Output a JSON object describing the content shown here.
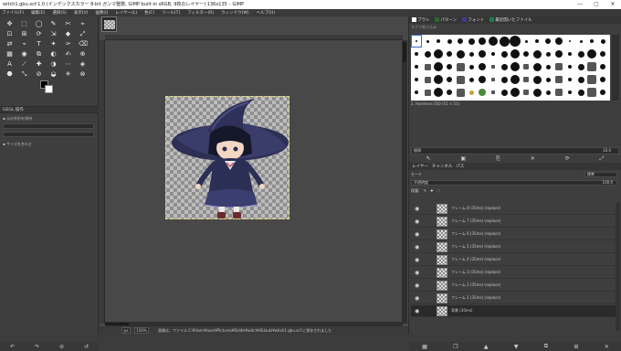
{
  "window": {
    "title": "witch1.gbu.xcf-1.0 (インデックスカラー 8-bit ガンマ整数, GIMP built-in sRGB, 9枚のレイヤー) 136x135 – GIMP",
    "controls": [
      "—",
      "▢",
      "✕"
    ]
  },
  "menu": [
    "ファイル(F)",
    "編集(E)",
    "選択(S)",
    "表示(V)",
    "画像(I)",
    "レイヤー(L)",
    "色(C)",
    "ツール(T)",
    "フィルター(R)",
    "ウィンドウ(W)",
    "ヘルプ(H)"
  ],
  "toolbox": {
    "tool_icons": [
      "✥",
      "⬚",
      "◯",
      "✎",
      "✂",
      "⌖",
      "⊡",
      "⊞",
      "⟳",
      "⇲",
      "◆",
      "⤢",
      "⇄",
      "⌁",
      "T",
      "✦",
      "✑",
      "⌫",
      "▦",
      "◉",
      "⧉",
      "◐",
      "✍",
      "⊕",
      "A",
      "⟋",
      "✚",
      "◑",
      "⋯",
      "◈",
      "⬣",
      "⤡",
      "⊘",
      "◒",
      "✳",
      "⊗"
    ],
    "tool_options_title": "GEGL 操作",
    "option_label_1": "元の外形を保持",
    "option_label_2": "サイズを合わせ",
    "bottom_icons": [
      "↶",
      "↷",
      "⊘",
      "↺"
    ]
  },
  "canvas": {
    "status_unit": "px",
    "status_zoom": "100%",
    "status_message": "画像は、ファイル C:¥Users¥user¥Pictures¥Riddle¥witch¥SUzuki¥witch1.gbu.xcf に保存されました"
  },
  "dock": {
    "top_tabs": [
      {
        "label": "ブラシ",
        "color": "#ffffff"
      },
      {
        "label": "パターン",
        "color": "#2b6b2b"
      },
      {
        "label": "フォント",
        "color": "#3d3d8a"
      },
      {
        "label": "最近開いたファイル",
        "color": "#1f7a4f"
      }
    ],
    "brush_filter_placeholder": "タグで絞り込み",
    "brush_name": "2. Hardness 050 (51 × 51)",
    "spacing_label": "間隔",
    "spacing_value": "10.0",
    "brush_buttons": [
      "✎",
      "▣",
      "⎘",
      "✕",
      "⟳",
      "⤢"
    ],
    "layer_tabs": [
      "レイヤー",
      "チャンネル",
      "パス"
    ],
    "mode_label": "モード",
    "mode_value": "標準",
    "opacity_label": "不透明度",
    "opacity_value": "100.0",
    "lock_label": "保護:",
    "lock_icons": [
      "✎",
      "✚",
      "⛶"
    ],
    "layers": [
      {
        "name": "フレーム 8 (35ms) (replace)",
        "active": false
      },
      {
        "name": "フレーム 7 (35ms) (replace)",
        "active": false
      },
      {
        "name": "フレーム 6 (35ms) (replace)",
        "active": false
      },
      {
        "name": "フレーム 5 (35ms) (replace)",
        "active": false
      },
      {
        "name": "フレーム 4 (35ms) (replace)",
        "active": false
      },
      {
        "name": "フレーム 3 (35ms) (replace)",
        "active": false
      },
      {
        "name": "フレーム 2 (35ms) (replace)",
        "active": false
      },
      {
        "name": "フレーム 1 (35ms) (replace)",
        "active": false
      },
      {
        "name": "背景 (35ms)",
        "active": true
      }
    ],
    "layer_buttons": [
      "▦",
      "❐",
      "▲",
      "▼",
      "⧉",
      "⊞",
      "✕"
    ]
  }
}
